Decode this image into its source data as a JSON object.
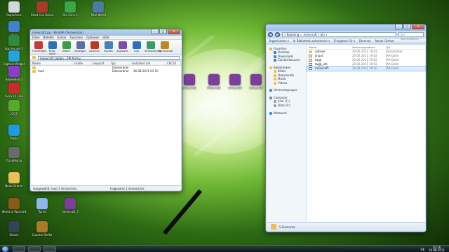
{
  "desktop": {
    "icons": [
      {
        "label": "Papierkorb",
        "icon": "recycle-bin-icon",
        "color": "#cfd8dc"
      },
      {
        "label": "Vuze",
        "icon": "vuze-icon",
        "color": "#3c82d0"
      },
      {
        "label": "Digitale Widget Launcher",
        "icon": "widget-icon",
        "color": "#27a2e0"
      },
      {
        "label": "Bejeweled 3",
        "icon": "game-icon",
        "color": "#8a3fc9"
      },
      {
        "label": "App Hunter 2",
        "icon": "app-icon",
        "color": "#2f8a3a"
      },
      {
        "label": "Avira 10 Free",
        "icon": "avira-icon",
        "color": "#cc2a2a"
      },
      {
        "label": "ICQ7",
        "icon": "icq-icon",
        "color": "#58a92e"
      },
      {
        "label": "Skype",
        "icon": "skype-icon",
        "color": "#1e9be0"
      },
      {
        "label": "TrackMania",
        "icon": "shortcut-icon",
        "color": "#6a6a6a"
      },
      {
        "label": "Neue Ordner",
        "icon": "folder-icon",
        "color": "#e8c15a"
      },
      {
        "label": "World of Warcraft",
        "icon": "wow-icon",
        "color": "#8a5a18"
      },
      {
        "label": "Steam",
        "icon": "steam-icon",
        "color": "#334455"
      },
      {
        "label": "Dead Can Demo",
        "icon": "game-icon",
        "color": "#a63b2a"
      },
      {
        "label": "Die Sims 3",
        "icon": "sims-icon",
        "color": "#3aa64a"
      },
      {
        "label": "Total World",
        "icon": "game-icon",
        "color": "#4d7aa6"
      },
      {
        "label": "iTunes",
        "icon": "itunes-icon",
        "color": "#8fb7e8"
      },
      {
        "label": "minecraft_3",
        "icon": "rar-icon",
        "color": "#7b3f9a"
      },
      {
        "label": "Counter-Strike",
        "icon": "game-icon",
        "color": "#a87a2a"
      }
    ],
    "mid_icons": [
      {
        "label": "minecraft",
        "icon": "rar-icon",
        "color": "#7b3f9a"
      },
      {
        "label": "Minecraft",
        "icon": "rar-icon",
        "color": "#7b3f9a"
      },
      {
        "label": "minecraft",
        "icon": "rar-icon",
        "color": "#7b3f9a"
      },
      {
        "label": "minecraft",
        "icon": "rar-icon",
        "color": "#7b3f9a"
      }
    ]
  },
  "winrar": {
    "title": "minecraft.zip - WinRAR (Testversion)",
    "menu": [
      "Datei",
      "Befehle",
      "Extras",
      "Favoriten",
      "Optionen",
      "Hilfe"
    ],
    "tools": [
      {
        "label": "Hinzufügen",
        "icon": "add-icon",
        "color": "#c23a3a"
      },
      {
        "label": "Entp. nach",
        "icon": "extract-icon",
        "color": "#2f6fb6"
      },
      {
        "label": "Testen",
        "icon": "test-icon",
        "color": "#3f9b4a"
      },
      {
        "label": "Anzeigen",
        "icon": "view-icon",
        "color": "#5a6fa0"
      },
      {
        "label": "Löschen",
        "icon": "delete-icon",
        "color": "#b83a2a"
      },
      {
        "label": "Suchen",
        "icon": "find-icon",
        "color": "#4a7fb8"
      },
      {
        "label": "Assistent",
        "icon": "wizard-icon",
        "color": "#7a4fa0"
      },
      {
        "label": "Info",
        "icon": "info-icon",
        "color": "#2f6fb6"
      },
      {
        "label": "Virenprüfung",
        "icon": "virus-scan-icon",
        "color": "#3a9a6a"
      },
      {
        "label": "Kommentar",
        "icon": "comment-icon",
        "color": "#b88a2a"
      }
    ],
    "path": "minecraft.zip\\bin - ZIP Archiv",
    "columns": [
      "Name",
      "Größe",
      "Gepackt",
      "Typ",
      "Geändert am",
      "CRC32"
    ],
    "rows": [
      {
        "name": "..",
        "size": "",
        "packed": "",
        "type": "Dateiordner",
        "modified": "",
        "crc": ""
      },
      {
        "name": "mod",
        "size": "",
        "packed": "",
        "type": "Dateiordner",
        "modified": "26.08.2011 01:10",
        "crc": ""
      }
    ],
    "status_left": "Ausgewählt: mod 1 Verzeichnis",
    "status_right": "Insgesamt 1 Verzeichnis"
  },
  "explorer": {
    "address": "« Roaming » .minecraft » bin »",
    "search_placeholder": "bin durchsuchen",
    "commands": [
      "Organisieren ▾",
      "In Bibliothek aufnehmen ▾",
      "Freigeben für ▾",
      "Brennen",
      "Neuer Ordner"
    ],
    "nav": [
      {
        "label": "Favoriten",
        "icon": "star-icon",
        "color": "#e8b92f",
        "indent": 0
      },
      {
        "label": "Desktop",
        "icon": "desktop-icon",
        "color": "#3c82d0",
        "indent": 1
      },
      {
        "label": "Downloads",
        "icon": "downloads-icon",
        "color": "#3c82d0",
        "indent": 1
      },
      {
        "label": "Zuletzt besucht",
        "icon": "recent-icon",
        "color": "#3c82d0",
        "indent": 1
      },
      {
        "label": "",
        "icon": "",
        "color": "",
        "indent": 0
      },
      {
        "label": "Bibliotheken",
        "icon": "library-icon",
        "color": "#e8c15a",
        "indent": 0
      },
      {
        "label": "Bilder",
        "icon": "pictures-icon",
        "color": "#e8c15a",
        "indent": 1
      },
      {
        "label": "Dokumente",
        "icon": "documents-icon",
        "color": "#e8c15a",
        "indent": 1
      },
      {
        "label": "Musik",
        "icon": "music-icon",
        "color": "#e8c15a",
        "indent": 1
      },
      {
        "label": "Videos",
        "icon": "videos-icon",
        "color": "#e8c15a",
        "indent": 1
      },
      {
        "label": "",
        "icon": "",
        "color": "",
        "indent": 0
      },
      {
        "label": "Heimnetzgruppe",
        "icon": "homegroup-icon",
        "color": "#3a9ad0",
        "indent": 0
      },
      {
        "label": "",
        "icon": "",
        "color": "",
        "indent": 0
      },
      {
        "label": "Computer",
        "icon": "computer-icon",
        "color": "#7a8a9a",
        "indent": 0
      },
      {
        "label": "Acer (C:)",
        "icon": "drive-icon",
        "color": "#9aa6b2",
        "indent": 1
      },
      {
        "label": "Data (D:)",
        "icon": "drive-icon",
        "color": "#9aa6b2",
        "indent": 1
      },
      {
        "label": "",
        "icon": "",
        "color": "",
        "indent": 0
      },
      {
        "label": "Netzwerk",
        "icon": "network-icon",
        "color": "#3a9ad0",
        "indent": 0
      }
    ],
    "columns": [
      "Name",
      "Änderungsdatum",
      "Typ"
    ],
    "rows": [
      {
        "name": "natives",
        "date": "20.06.2011 19:02",
        "type": "Dateiordner",
        "selected": false
      },
      {
        "name": "jinput",
        "date": "20.06.2011 19:02",
        "type": "JAR-Datei",
        "selected": false
      },
      {
        "name": "lwjgl",
        "date": "20.06.2011 19:02",
        "type": "JAR-Datei",
        "selected": false
      },
      {
        "name": "lwjgl_util",
        "date": "20.06.2011 19:02",
        "type": "JAR-Datei",
        "selected": false
      },
      {
        "name": "minecraft",
        "date": "26.08.2011 18:10",
        "type": "JAR-Datei",
        "selected": true
      }
    ],
    "details": "5 Elemente"
  },
  "taskbar": {
    "lang": "DE",
    "time": "20:16",
    "date": "26.08.2011"
  }
}
